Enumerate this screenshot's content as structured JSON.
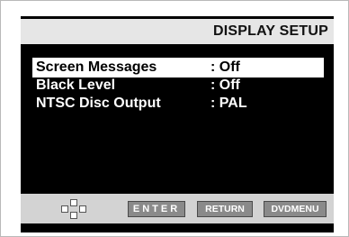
{
  "header": {
    "title": "DISPLAY SETUP"
  },
  "menu": {
    "items": [
      {
        "label": "Screen Messages",
        "value": ": Off"
      },
      {
        "label": "Black Level",
        "value": ": Off"
      },
      {
        "label": "NTSC Disc Output",
        "value": ": PAL"
      }
    ]
  },
  "footer": {
    "nav_icon": "dpad-icon",
    "enter_label": "ENTER",
    "return_label": "RETURN",
    "menu_label": "DVDMENU"
  }
}
